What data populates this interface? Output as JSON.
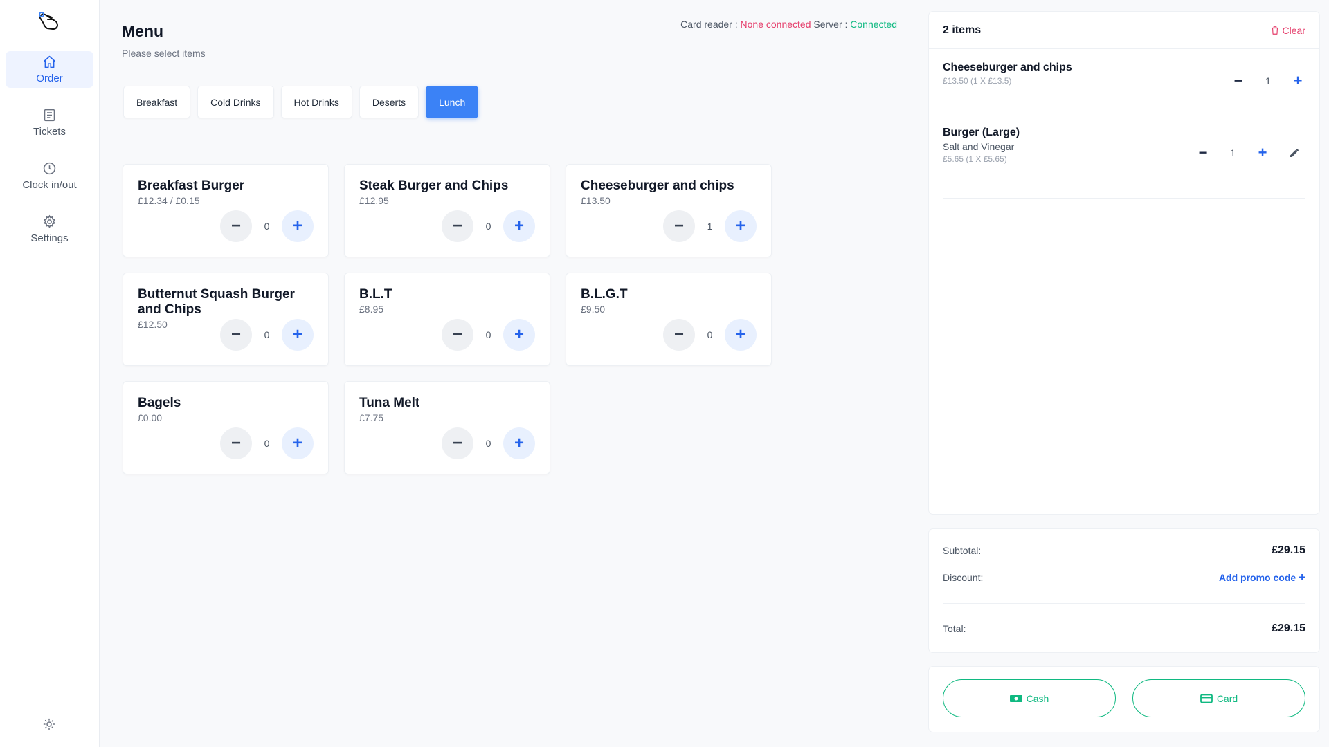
{
  "sidebar": {
    "items": [
      {
        "label": "Order",
        "icon": "home-icon",
        "active": true
      },
      {
        "label": "Tickets",
        "icon": "tickets-icon"
      },
      {
        "label": "Clock in/out",
        "icon": "clock-icon"
      },
      {
        "label": "Settings",
        "icon": "gear-icon"
      }
    ],
    "footer_icon": "sun-icon"
  },
  "header": {
    "title": "Menu",
    "subtitle": "Please select items",
    "card_reader_label": "Card reader :",
    "card_reader_status": "None connected",
    "server_label": "Server :",
    "server_status": "Connected"
  },
  "categories": [
    "Breakfast",
    "Cold Drinks",
    "Hot Drinks",
    "Deserts",
    "Lunch"
  ],
  "active_category": "Lunch",
  "menu_items": [
    {
      "name": "Breakfast Burger",
      "price": "£12.34 / £0.15",
      "qty": "0"
    },
    {
      "name": "Steak Burger and Chips",
      "price": "£12.95",
      "qty": "0"
    },
    {
      "name": "Cheeseburger and chips",
      "price": "£13.50",
      "qty": "1"
    },
    {
      "name": "Butternut Squash Burger and Chips",
      "price": "£12.50",
      "qty": "0"
    },
    {
      "name": "B.L.T",
      "price": "£8.95",
      "qty": "0"
    },
    {
      "name": "B.L.G.T",
      "price": "£9.50",
      "qty": "0"
    },
    {
      "name": "Bagels",
      "price": "£0.00",
      "qty": "0"
    },
    {
      "name": "Tuna Melt",
      "price": "£7.75",
      "qty": "0"
    }
  ],
  "cart": {
    "count_label": "2 items",
    "clear_label": "Clear",
    "items": [
      {
        "name": "Cheeseburger and chips",
        "modifier": "",
        "detail": "£13.50 (1 X £13.5)",
        "qty": "1"
      },
      {
        "name": "Burger (Large)",
        "modifier": "Salt and Vinegar",
        "detail": "£5.65 (1 X £5.65)",
        "qty": "1"
      }
    ]
  },
  "summary": {
    "subtotal_label": "Subtotal:",
    "subtotal_value": "£29.15",
    "discount_label": "Discount:",
    "promo_label": "Add promo code",
    "total_label": "Total:",
    "total_value": "£29.15"
  },
  "payment": {
    "cash_label": "Cash",
    "card_label": "Card"
  },
  "colors": {
    "accent": "#3b82f6",
    "danger": "#e53e6b",
    "success": "#10b981"
  }
}
